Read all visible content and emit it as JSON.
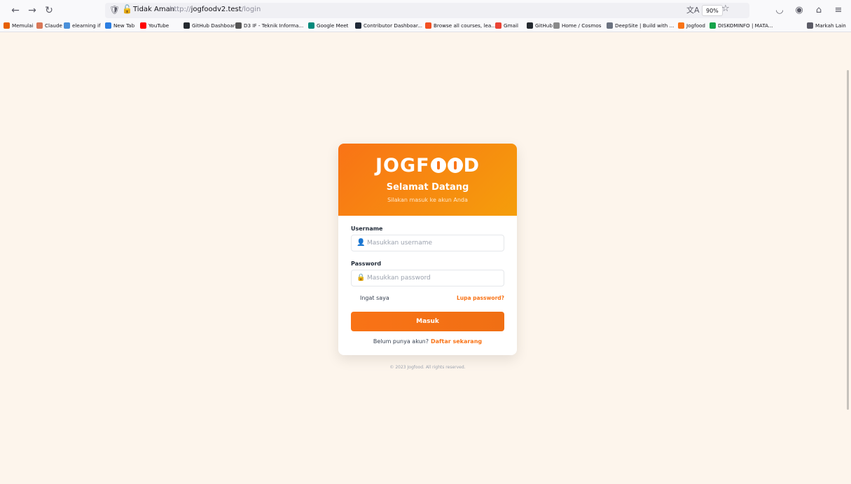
{
  "browser": {
    "security_label": "Tidak Aman",
    "url_prefix": "http://",
    "url_host": "jogfoodv2.test",
    "url_path": "/login",
    "zoom": "90%",
    "bookmarks": [
      {
        "label": "Memulai",
        "color": "#e66000"
      },
      {
        "label": "Claude",
        "color": "#d97757"
      },
      {
        "label": "elearning if",
        "color": "#4a90d9"
      },
      {
        "label": "New Tab",
        "color": "#2a7de1"
      },
      {
        "label": "YouTube",
        "color": "#ff0000"
      },
      {
        "label": "GitHub Dashboard",
        "color": "#24292f"
      },
      {
        "label": "D3 IF - Teknik Informa...",
        "color": "#555555"
      },
      {
        "label": "Google Meet",
        "color": "#00897b"
      },
      {
        "label": "Contributor Dashboar...",
        "color": "#1f2937"
      },
      {
        "label": "Browse all courses, lea...",
        "color": "#f25022"
      },
      {
        "label": "Gmail",
        "color": "#ea4335"
      },
      {
        "label": "GitHub",
        "color": "#24292f"
      },
      {
        "label": "Home / Cosmos",
        "color": "#8a8a8a"
      },
      {
        "label": "DeepSite | Build with ...",
        "color": "#6b7280"
      },
      {
        "label": "Jogfood",
        "color": "#f97316"
      },
      {
        "label": "DISKOMINFO | MATA...",
        "color": "#16a34a"
      },
      {
        "label": "Markah Lain",
        "color": "#5b5b66"
      }
    ]
  },
  "login": {
    "logo_left": "JOGF",
    "logo_right": "D",
    "welcome": "Selamat Datang",
    "welcome_sub": "Silakan masuk ke akun Anda",
    "username_label": "Username",
    "username_placeholder": "Masukkan username",
    "password_label": "Password",
    "password_placeholder": "Masukkan password",
    "remember_label": "Ingat saya",
    "forgot_label": "Lupa password?",
    "submit_label": "Masuk",
    "register_prompt": "Belum punya akun?",
    "register_link": "Daftar sekarang",
    "footer": "© 2023 Jogfood. All rights reserved."
  },
  "colors": {
    "accent": "#f97316",
    "page_bg": "#fdf5ec"
  }
}
